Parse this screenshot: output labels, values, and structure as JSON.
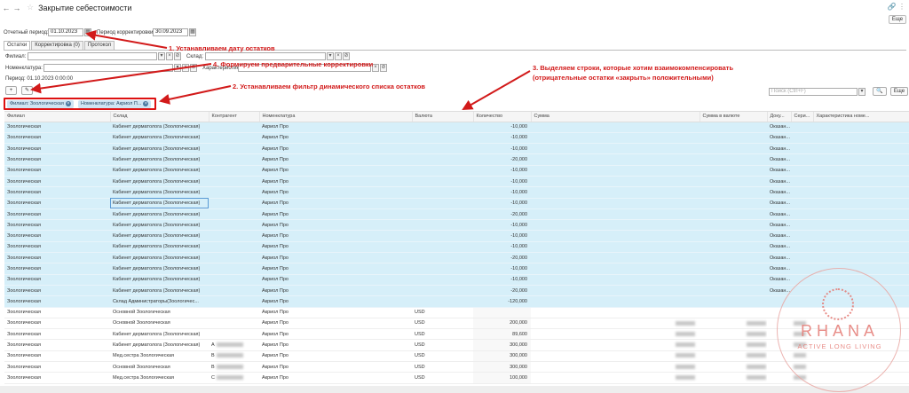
{
  "window": {
    "back": "←",
    "forward": "→",
    "title": "Закрытие себестоимости",
    "link_icon": "🔗",
    "more_icon": "⋮",
    "more_button": "Еще"
  },
  "params": {
    "period_label": "Отчетный период:",
    "period_value": "01.10.2023",
    "corr_label": "Период корректировки:",
    "corr_value": "30.09.2023"
  },
  "tabs": [
    {
      "label": "Остатки"
    },
    {
      "label": "Корректировка (0)"
    },
    {
      "label": "Протокол"
    }
  ],
  "filters": {
    "branch_label": "Филиал:",
    "warehouse_label": "Склад:",
    "nomenclature_label": "Номенклатура:",
    "characteristic_label": "Характеристика",
    "period_text": "Период: 01.10.2023 0:00:00"
  },
  "chips": [
    {
      "label": "Филиал: Зоологическая"
    },
    {
      "label": "Номенклатура: Акриол П..."
    }
  ],
  "search": {
    "placeholder": "Поиск (Ctrl+F)",
    "more_button": "Еще"
  },
  "annotations": {
    "a1": "1. Устанавливаем дату остатков",
    "a4": "4. Формируем предварительные корректировки",
    "a2": "2. Устанавливаем фильтр динамического списка остатков",
    "a3_line1": "3. Выделяем строки, которые хотим взаимокомпенсировать",
    "a3_line2": "(отрицательные остатки «закрыть» положительными)"
  },
  "table": {
    "columns": [
      "Филиал",
      "Склад",
      "Контрагент",
      "Номенклатура",
      "Валюта",
      "Количество",
      "Сумма",
      "Сумма в валюте",
      "Доку...",
      "Сери...",
      "Характеристика номе..."
    ],
    "rows": [
      {
        "branch": "Зоологическая",
        "warehouse": "Кабинет дерматолога (Зоологическая)",
        "counterparty": "",
        "item": "Акриол Про",
        "currency": "",
        "qty": "-10,000",
        "doc": "Оказан..."
      },
      {
        "branch": "Зоологическая",
        "warehouse": "Кабинет дерматолога (Зоологическая)",
        "counterparty": "",
        "item": "Акриол Про",
        "currency": "",
        "qty": "-10,000",
        "doc": "Оказан..."
      },
      {
        "branch": "Зоологическая",
        "warehouse": "Кабинет дерматолога (Зоологическая)",
        "counterparty": "",
        "item": "Акриол Про",
        "currency": "",
        "qty": "-10,000",
        "doc": "Оказан..."
      },
      {
        "branch": "Зоологическая",
        "warehouse": "Кабинет дерматолога (Зоологическая)",
        "counterparty": "",
        "item": "Акриол Про",
        "currency": "",
        "qty": "-20,000",
        "doc": "Оказан..."
      },
      {
        "branch": "Зоологическая",
        "warehouse": "Кабинет дерматолога (Зоологическая)",
        "counterparty": "",
        "item": "Акриол Про",
        "currency": "",
        "qty": "-10,000",
        "doc": "Оказан..."
      },
      {
        "branch": "Зоологическая",
        "warehouse": "Кабинет дерматолога (Зоологическая)",
        "counterparty": "",
        "item": "Акриол Про",
        "currency": "",
        "qty": "-10,000",
        "doc": "Оказан..."
      },
      {
        "branch": "Зоологическая",
        "warehouse": "Кабинет дерматолога (Зоологическая)",
        "counterparty": "",
        "item": "Акриол Про",
        "currency": "",
        "qty": "-10,000",
        "doc": "Оказан..."
      },
      {
        "branch": "Зоологическая",
        "warehouse": "Кабинет дерматолога (Зоологическая)",
        "counterparty": "",
        "item": "Акриол Про",
        "currency": "",
        "qty": "-10,000",
        "doc": "Оказан..."
      },
      {
        "branch": "Зоологическая",
        "warehouse": "Кабинет дерматолога (Зоологическая)",
        "counterparty": "",
        "item": "Акриол Про",
        "currency": "",
        "qty": "-20,000",
        "doc": "Оказан..."
      },
      {
        "branch": "Зоологическая",
        "warehouse": "Кабинет дерматолога (Зоологическая)",
        "counterparty": "",
        "item": "Акриол Про",
        "currency": "",
        "qty": "-10,000",
        "doc": "Оказан..."
      },
      {
        "branch": "Зоологическая",
        "warehouse": "Кабинет дерматолога (Зоологическая)",
        "counterparty": "",
        "item": "Акриол Про",
        "currency": "",
        "qty": "-10,000",
        "doc": "Оказан..."
      },
      {
        "branch": "Зоологическая",
        "warehouse": "Кабинет дерматолога (Зоологическая)",
        "counterparty": "",
        "item": "Акриол Про",
        "currency": "",
        "qty": "-10,000",
        "doc": "Оказан..."
      },
      {
        "branch": "Зоологическая",
        "warehouse": "Кабинет дерматолога (Зоологическая)",
        "counterparty": "",
        "item": "Акриол Про",
        "currency": "",
        "qty": "-20,000",
        "doc": "Оказан..."
      },
      {
        "branch": "Зоологическая",
        "warehouse": "Кабинет дерматолога (Зоологическая)",
        "counterparty": "",
        "item": "Акриол Про",
        "currency": "",
        "qty": "-10,000",
        "doc": "Оказан..."
      },
      {
        "branch": "Зоологическая",
        "warehouse": "Кабинет дерматолога (Зоологическая)",
        "counterparty": "",
        "item": "Акриол Про",
        "currency": "",
        "qty": "-10,000",
        "doc": "Оказан..."
      },
      {
        "branch": "Зоологическая",
        "warehouse": "Кабинет дерматолога (Зоологическая)",
        "counterparty": "",
        "item": "Акриол Про",
        "currency": "",
        "qty": "-20,000",
        "doc": "Оказан..."
      },
      {
        "branch": "Зоологическая",
        "warehouse": "Склад Администраторы(Зоологичес...",
        "counterparty": "",
        "item": "Акриол Про",
        "currency": "",
        "qty": "-120,000",
        "doc": ""
      },
      {
        "branch": "Зоологическая",
        "warehouse": "Основной Зоологическая",
        "counterparty": "",
        "item": "Акриол Про",
        "currency": "USD",
        "qty": "",
        "doc": ""
      },
      {
        "branch": "Зоологическая",
        "warehouse": "Основной Зоологическая",
        "counterparty": "",
        "item": "Акриол Про",
        "currency": "USD",
        "qty": "200,000",
        "doc": ""
      },
      {
        "branch": "Зоологическая",
        "warehouse": "Кабинет дерматолога (Зоологическая)",
        "counterparty": "",
        "item": "Акриол Про",
        "currency": "USD",
        "qty": "89,600",
        "doc": ""
      },
      {
        "branch": "Зоологическая",
        "warehouse": "Кабинет дерматолога (Зоологическая)",
        "counterparty": "А",
        "item": "Акриол Про",
        "currency": "USD",
        "qty": "300,000",
        "doc": ""
      },
      {
        "branch": "Зоологическая",
        "warehouse": "Мед.сестра Зоологическая",
        "counterparty": "В",
        "item": "Акриол Про",
        "currency": "USD",
        "qty": "300,000",
        "doc": ""
      },
      {
        "branch": "Зоологическая",
        "warehouse": "Основной Зоологическая",
        "counterparty": "В",
        "item": "Акриол Про",
        "currency": "USD",
        "qty": "300,000",
        "doc": ""
      },
      {
        "branch": "Зоологическая",
        "warehouse": "Мед.сестра Зоологическая",
        "counterparty": "С",
        "item": "Акриол Про",
        "currency": "USD",
        "qty": "100,000",
        "doc": ""
      }
    ]
  },
  "watermark": {
    "brand": "RHANA",
    "tagline": "ACTIVE LONG LIVING"
  }
}
